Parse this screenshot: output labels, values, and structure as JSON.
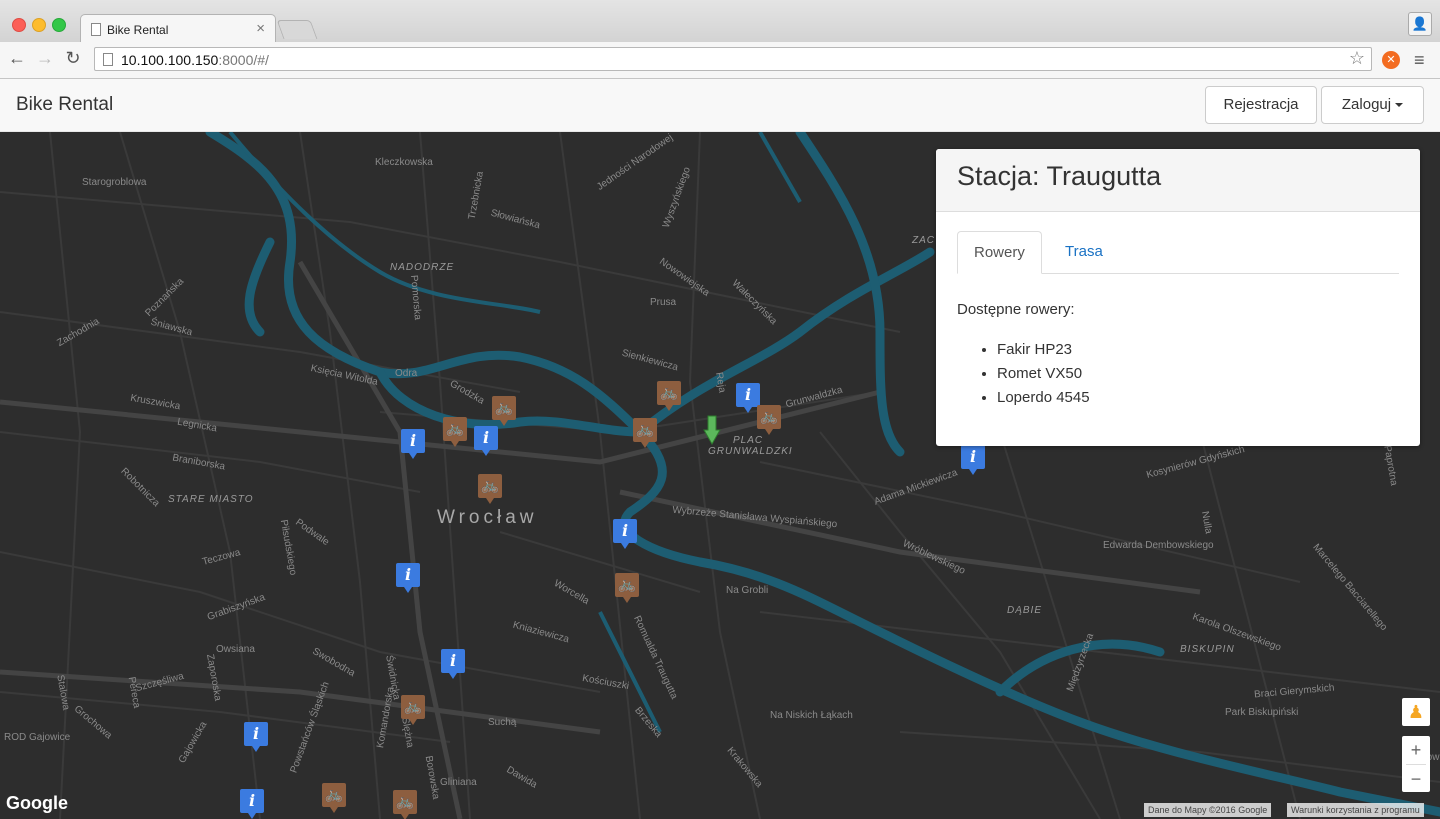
{
  "browser": {
    "tab_title": "Bike Rental",
    "url_host": "10.100.100.150",
    "url_rest": ":8000/#/"
  },
  "navbar": {
    "brand": "Bike Rental",
    "register_label": "Rejestracja",
    "login_label": "Zaloguj"
  },
  "map": {
    "city_label": "Wrocław",
    "districts": [
      "NADODRZE",
      "STARE MIASTO",
      "PLAC",
      "GRUNWALDZKI",
      "DĄBIE",
      "BISKUPIN",
      "ZAC"
    ],
    "streets": [
      "Kleczkowska",
      "Starogroblowa",
      "Trzebnicka",
      "Jedności Narodowej",
      "Słowiańska",
      "Wyszyńskiego",
      "Nowowiejska",
      "Prusa",
      "Wałeczyńska",
      "Pomorska",
      "Poznańska",
      "Zachodnia",
      "Śniawska",
      "Księcia Witolda",
      "Odra",
      "Grodzka",
      "Kruszwicka",
      "Legnicka",
      "Braniborska",
      "Robotnicza",
      "Sienkiewicza",
      "Reja",
      "Grunwaldzka",
      "Teczowa",
      "Podwale",
      "Piłsudskiego",
      "Grabiszyńska",
      "Owsiana",
      "Swobodna",
      "Świdnicka",
      "Kościuszki",
      "Worcella",
      "Kniaziewicza",
      "Wybrzeże Stanisława Wyspiańskiego",
      "Na Grobli",
      "Adama Mickiewicza",
      "Wróblewskiego",
      "Edwarda Dembowskiego",
      "Karola Olszewskiego",
      "Kosynierów Gdyńskich",
      "Nulla",
      "Marcelego Bacciarellego",
      "Międzyrzecka",
      "Na Niskich Łąkach",
      "Braci Gierymskich",
      "Park Biskupiński",
      "Suchą",
      "Brzeska",
      "Krakowska",
      "Gliniana",
      "Dawida",
      "ROD Gajowice",
      "Zaporoska",
      "Grochowa",
      "Pereca",
      "Szczęśliwa",
      "Stalowa",
      "Romualda Traugutta",
      "Paprotna",
      "Opatowicka",
      "Borowska",
      "Ślężna",
      "Komandorska",
      "Powstańców Śląskich",
      "Gajowicka",
      "Prusa"
    ],
    "google_label": "Google",
    "attribution_data": "Dane do Mapy ©2016 Google",
    "attribution_terms": "Warunki korzystania z programu",
    "zoom_in": "+",
    "zoom_out": "−",
    "info_icon": "i",
    "bike_icon": "bicycle-icon",
    "pegman_icon": "person-icon"
  },
  "station": {
    "title": "Stacja: Traugutta",
    "tabs": [
      "Rowery",
      "Trasa"
    ],
    "available_label": "Dostępne rowery:",
    "bikes": [
      "Fakir HP23",
      "Romet VX50",
      "Loperdo 4545"
    ]
  },
  "colors": {
    "info_marker": "#3b7be0",
    "bike_marker": "#8d5e3f",
    "user_marker": "#5cb85c",
    "river": "#1d5d72",
    "map_bg": "#2d2d2d",
    "link": "#1a72c4"
  }
}
